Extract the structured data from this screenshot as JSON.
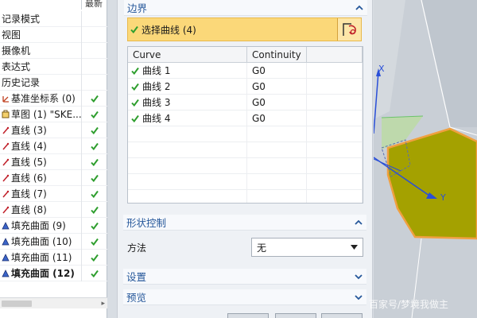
{
  "navigator": {
    "latest_header": "最新",
    "rows": [
      {
        "label": "记录模式",
        "icon": "none-icon",
        "checked": false,
        "bold": false
      },
      {
        "label": "视图",
        "icon": "none-icon",
        "checked": false,
        "bold": false
      },
      {
        "label": "摄像机",
        "icon": "none-icon",
        "checked": false,
        "bold": false
      },
      {
        "label": "表达式",
        "icon": "none-icon",
        "checked": false,
        "bold": false
      },
      {
        "label": "历史记录",
        "icon": "none-icon",
        "checked": false,
        "bold": false
      },
      {
        "label": "基准坐标系 (0)",
        "icon": "datum-csys-icon",
        "checked": true,
        "bold": false
      },
      {
        "label": "草图 (1) \"SKE...",
        "icon": "sketch-icon",
        "checked": true,
        "bold": false
      },
      {
        "label": "直线 (3)",
        "icon": "line-icon",
        "checked": true,
        "bold": false
      },
      {
        "label": "直线 (4)",
        "icon": "line-icon",
        "checked": true,
        "bold": false
      },
      {
        "label": "直线 (5)",
        "icon": "line-icon",
        "checked": true,
        "bold": false
      },
      {
        "label": "直线 (6)",
        "icon": "line-icon",
        "checked": true,
        "bold": false
      },
      {
        "label": "直线 (7)",
        "icon": "line-icon",
        "checked": true,
        "bold": false
      },
      {
        "label": "直线 (8)",
        "icon": "line-icon",
        "checked": true,
        "bold": false
      },
      {
        "label": "填充曲面 (9)",
        "icon": "fill-surface-icon",
        "checked": true,
        "bold": false
      },
      {
        "label": "填充曲面 (10)",
        "icon": "fill-surface-icon",
        "checked": true,
        "bold": false
      },
      {
        "label": "填充曲面 (11)",
        "icon": "fill-surface-icon",
        "checked": true,
        "bold": false
      },
      {
        "label": "填充曲面 (12)",
        "icon": "fill-surface-icon",
        "checked": true,
        "bold": true
      }
    ]
  },
  "dialog": {
    "boundary_title": "边界",
    "select_label": "选择曲线 (4)",
    "table": {
      "columns": [
        "Curve",
        "Continuity"
      ],
      "rows": [
        {
          "curve": "曲线 1",
          "continuity": "G0"
        },
        {
          "curve": "曲线 2",
          "continuity": "G0"
        },
        {
          "curve": "曲线 3",
          "continuity": "G0"
        },
        {
          "curve": "曲线 4",
          "continuity": "G0"
        }
      ]
    },
    "shape_control_title": "形状控制",
    "method_label": "方法",
    "method_value": "无",
    "settings_title": "设置",
    "preview_title": "预览"
  },
  "viewport": {
    "axis_x": "X",
    "axis_y": "Y",
    "watermark": "百家号/梦境我做主"
  },
  "colors": {
    "check_green": "#2e9e2e",
    "section_blue": "#25579a",
    "select_yellow": "#fbd879",
    "surface_olive": "#a4a100",
    "edge_orange": "#f0a040"
  }
}
